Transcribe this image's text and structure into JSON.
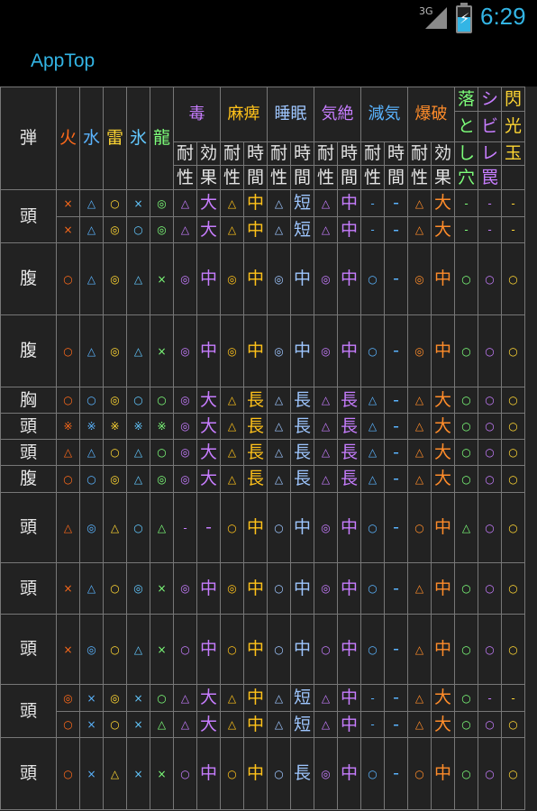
{
  "status_bar": {
    "network": "3G",
    "time": "6:29"
  },
  "app": {
    "title": "AppTop"
  },
  "table": {
    "header": {
      "shot": "弾",
      "elements": [
        "火",
        "水",
        "雷",
        "氷",
        "龍"
      ],
      "ailments": [
        "毒",
        "麻痺",
        "睡眠",
        "気絶",
        "減気",
        "爆破"
      ],
      "sub_labels": [
        [
          "耐",
          "効"
        ],
        [
          "耐",
          "時"
        ],
        [
          "耐",
          "時"
        ],
        [
          "耐",
          "時"
        ],
        [
          "耐",
          "時"
        ],
        [
          "耐",
          "効"
        ]
      ],
      "sub_labels2": [
        [
          "性",
          "果"
        ],
        [
          "性",
          "間"
        ],
        [
          "性",
          "間"
        ],
        [
          "性",
          "間"
        ],
        [
          "性",
          "間"
        ],
        [
          "性",
          "果"
        ]
      ],
      "traps": [
        [
          "落",
          "と",
          "し",
          "穴"
        ],
        [
          "シ",
          "ビ",
          "レ",
          "罠"
        ],
        [
          "閃",
          "光",
          "玉"
        ]
      ]
    },
    "groups": [
      {
        "label": "頭",
        "rows": [
          [
            "×",
            "△",
            "○",
            "×",
            "◎",
            "△",
            "大",
            "△",
            "中",
            "△",
            "短",
            "△",
            "中",
            "-",
            "-",
            "△",
            "大",
            "-",
            "-",
            "-"
          ],
          [
            "×",
            "△",
            "◎",
            "○",
            "◎",
            "△",
            "大",
            "△",
            "中",
            "△",
            "短",
            "△",
            "中",
            "-",
            "-",
            "△",
            "大",
            "-",
            "-",
            "-"
          ]
        ]
      },
      {
        "label": "腹",
        "rows": [
          [
            "○",
            "△",
            "◎",
            "△",
            "×",
            "◎",
            "中",
            "◎",
            "中",
            "◎",
            "中",
            "◎",
            "中",
            "○",
            "-",
            "◎",
            "中",
            "○",
            "○",
            "○"
          ]
        ]
      },
      {
        "label": "腹",
        "rows": [
          [
            "○",
            "△",
            "◎",
            "△",
            "×",
            "◎",
            "中",
            "◎",
            "中",
            "◎",
            "中",
            "◎",
            "中",
            "○",
            "-",
            "◎",
            "中",
            "○",
            "○",
            "○"
          ]
        ]
      },
      {
        "label": "胸",
        "rows": [
          [
            "○",
            "○",
            "◎",
            "○",
            "○",
            "◎",
            "大",
            "△",
            "長",
            "△",
            "長",
            "△",
            "長",
            "△",
            "-",
            "△",
            "大",
            "○",
            "○",
            "○"
          ]
        ]
      },
      {
        "label": "頭",
        "rows": [
          [
            "※",
            "※",
            "※",
            "※",
            "※",
            "◎",
            "大",
            "△",
            "長",
            "△",
            "長",
            "△",
            "長",
            "△",
            "-",
            "△",
            "大",
            "○",
            "○",
            "○"
          ]
        ]
      },
      {
        "label": "頭",
        "rows": [
          [
            "△",
            "△",
            "○",
            "△",
            "○",
            "◎",
            "大",
            "△",
            "長",
            "△",
            "長",
            "△",
            "長",
            "△",
            "-",
            "△",
            "大",
            "○",
            "○",
            "○"
          ]
        ]
      },
      {
        "label": "腹",
        "rows": [
          [
            "○",
            "○",
            "◎",
            "△",
            "◎",
            "◎",
            "大",
            "△",
            "長",
            "△",
            "長",
            "△",
            "長",
            "△",
            "-",
            "△",
            "大",
            "○",
            "○",
            "○"
          ]
        ]
      },
      {
        "label": "頭",
        "rows": [
          [
            "△",
            "◎",
            "△",
            "○",
            "△",
            "-",
            "-",
            "○",
            "中",
            "○",
            "中",
            "◎",
            "中",
            "○",
            "-",
            "○",
            "中",
            "△",
            "○",
            "○"
          ]
        ]
      },
      {
        "label": "頭",
        "rows": [
          [
            "×",
            "△",
            "○",
            "◎",
            "×",
            "◎",
            "中",
            "◎",
            "中",
            "○",
            "中",
            "◎",
            "中",
            "○",
            "-",
            "△",
            "中",
            "○",
            "○",
            "○"
          ]
        ]
      },
      {
        "label": "頭",
        "rows": [
          [
            "×",
            "◎",
            "○",
            "△",
            "×",
            "○",
            "中",
            "○",
            "中",
            "○",
            "中",
            "○",
            "中",
            "○",
            "-",
            "△",
            "中",
            "○",
            "○",
            "○"
          ]
        ]
      },
      {
        "label": "頭",
        "rows": [
          [
            "◎",
            "×",
            "◎",
            "×",
            "○",
            "△",
            "大",
            "△",
            "中",
            "△",
            "短",
            "△",
            "中",
            "-",
            "-",
            "△",
            "大",
            "○",
            "-",
            "-"
          ],
          [
            "○",
            "×",
            "○",
            "×",
            "△",
            "△",
            "大",
            "△",
            "中",
            "△",
            "短",
            "△",
            "中",
            "-",
            "-",
            "△",
            "大",
            "○",
            "○",
            "○"
          ]
        ]
      },
      {
        "label": "頭",
        "rows": [
          [
            "○",
            "×",
            "△",
            "×",
            "×",
            "○",
            "中",
            "○",
            "中",
            "○",
            "長",
            "◎",
            "中",
            "○",
            "-",
            "○",
            "中",
            "○",
            "○",
            "○"
          ]
        ]
      }
    ]
  }
}
